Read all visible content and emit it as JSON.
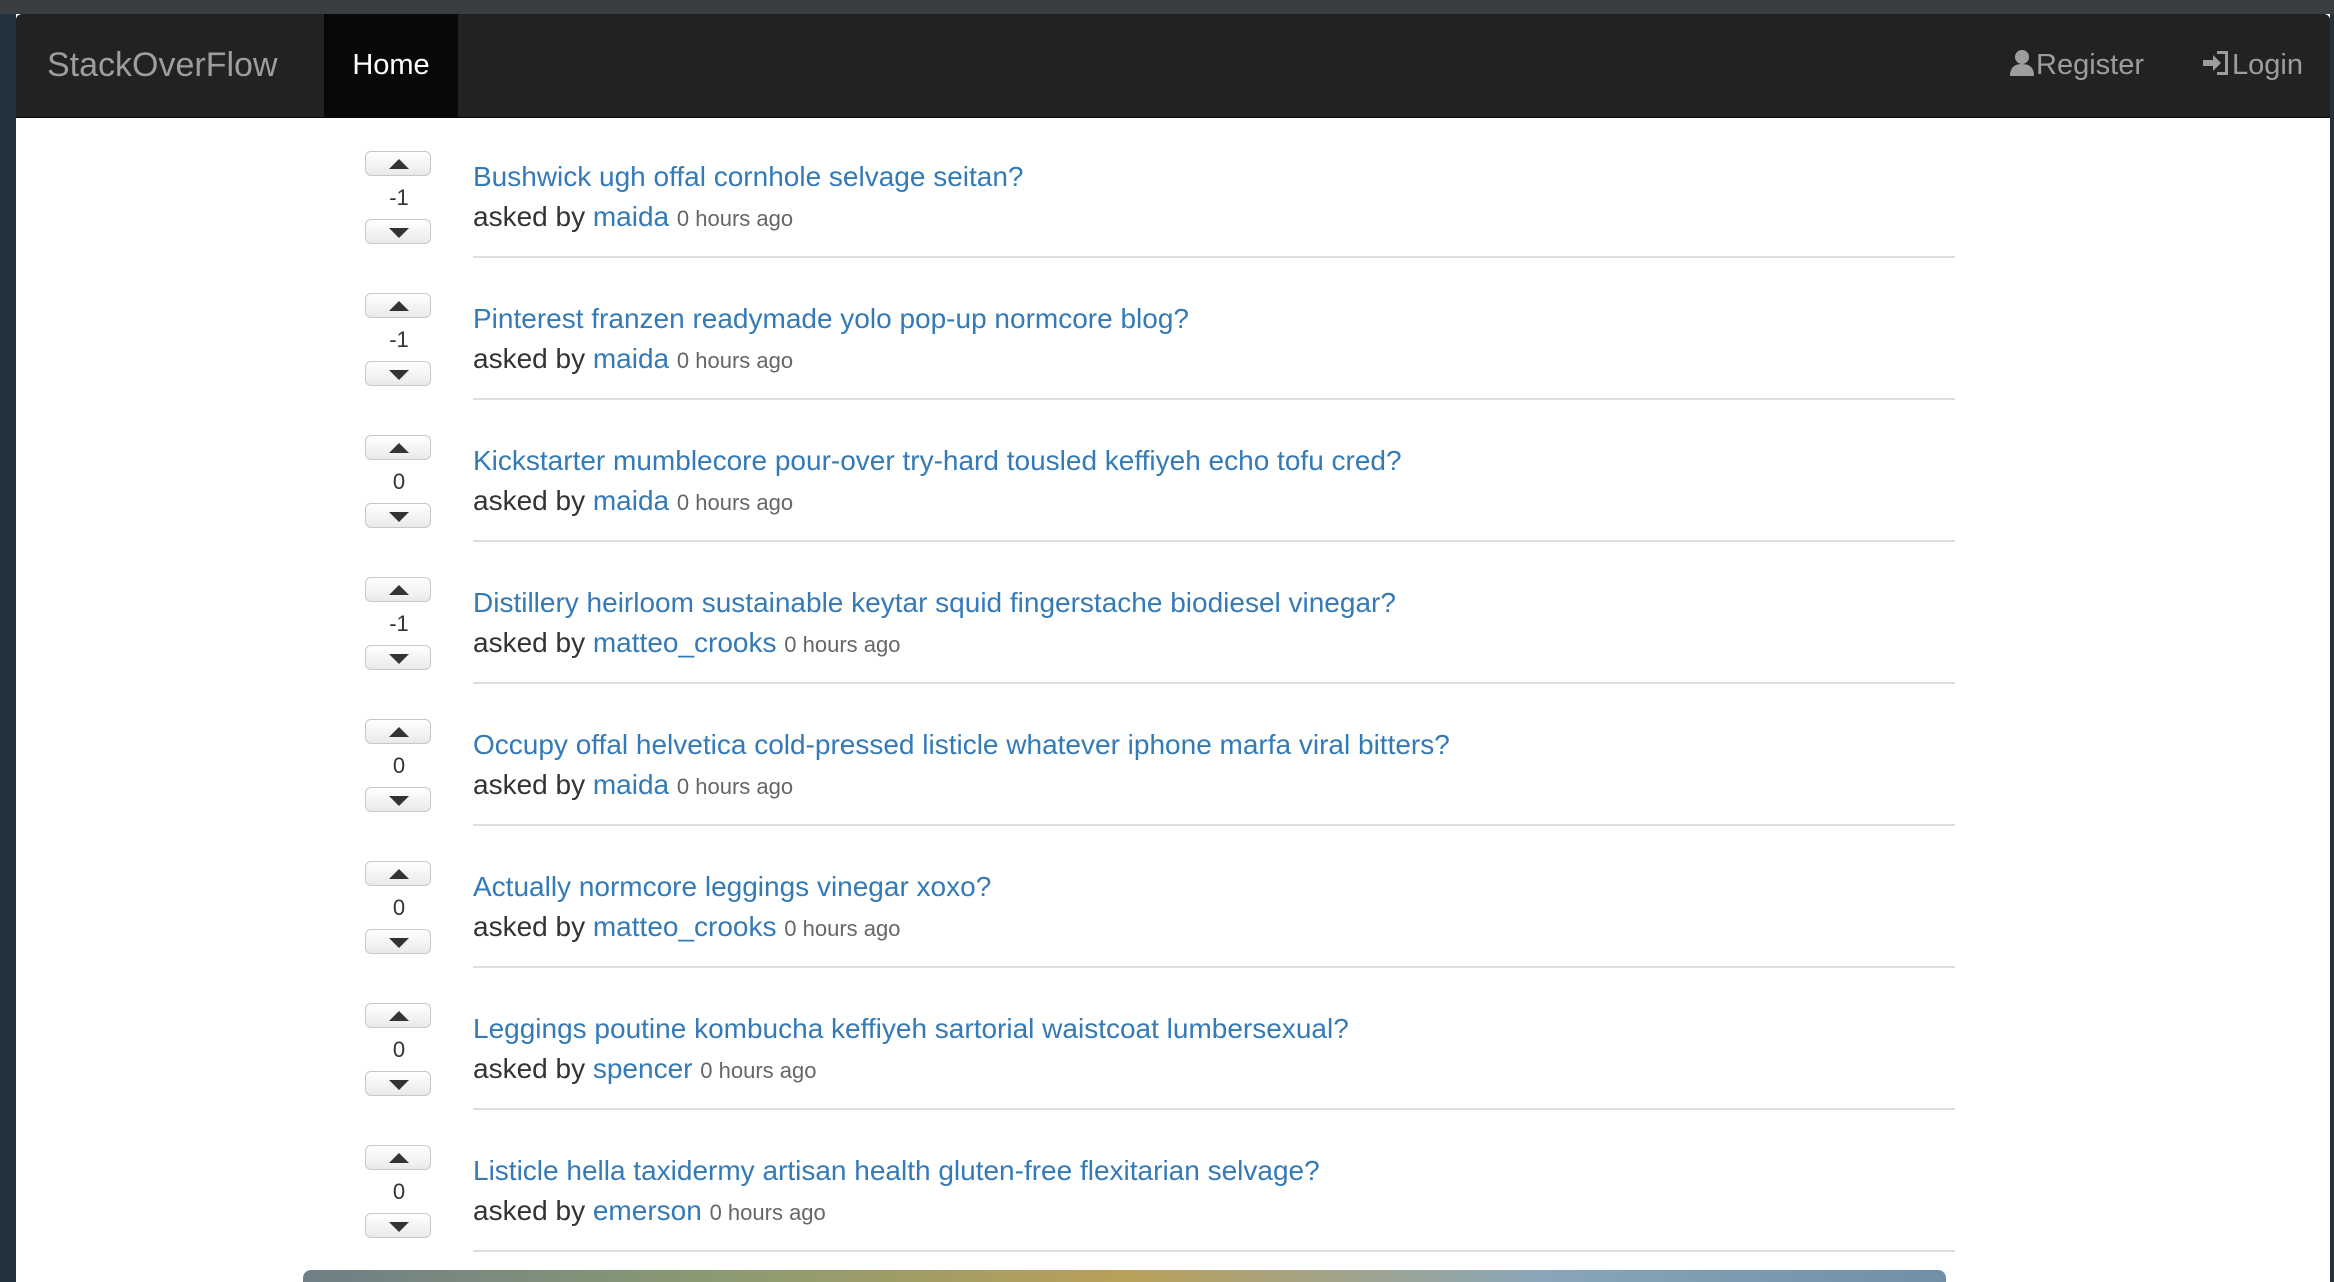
{
  "navbar": {
    "brand": "StackOverFlow",
    "home_label": "Home",
    "register_label": "Register",
    "login_label": "Login"
  },
  "questions": [
    {
      "votes": "-1",
      "title": "Bushwick ugh offal cornhole selvage seitan?",
      "asked_by_label": "asked by",
      "author": "maida",
      "time": "0 hours ago"
    },
    {
      "votes": "-1",
      "title": "Pinterest franzen readymade yolo pop-up normcore blog?",
      "asked_by_label": "asked by",
      "author": "maida",
      "time": "0 hours ago"
    },
    {
      "votes": "0",
      "title": "Kickstarter mumblecore pour-over try-hard tousled keffiyeh echo tofu cred?",
      "asked_by_label": "asked by",
      "author": "maida",
      "time": "0 hours ago"
    },
    {
      "votes": "-1",
      "title": "Distillery heirloom sustainable keytar squid fingerstache biodiesel vinegar?",
      "asked_by_label": "asked by",
      "author": "matteo_crooks",
      "time": "0 hours ago"
    },
    {
      "votes": "0",
      "title": "Occupy offal helvetica cold-pressed listicle whatever iphone marfa viral bitters?",
      "asked_by_label": "asked by",
      "author": "maida",
      "time": "0 hours ago"
    },
    {
      "votes": "0",
      "title": "Actually normcore leggings vinegar xoxo?",
      "asked_by_label": "asked by",
      "author": "matteo_crooks",
      "time": "0 hours ago"
    },
    {
      "votes": "0",
      "title": "Leggings poutine kombucha keffiyeh sartorial waistcoat lumbersexual?",
      "asked_by_label": "asked by",
      "author": "spencer",
      "time": "0 hours ago"
    },
    {
      "votes": "0",
      "title": "Listicle hella taxidermy artisan health gluten-free flexitarian selvage?",
      "asked_by_label": "asked by",
      "author": "emerson",
      "time": "0 hours ago"
    }
  ],
  "colors": {
    "navbar_bg": "#222222",
    "active_nav_bg": "#080808",
    "link": "#337ab7",
    "text": "#333333"
  },
  "icons": {
    "register": "user-icon",
    "login": "log-in-icon",
    "upvote": "triangle-up-icon",
    "downvote": "triangle-down-icon"
  }
}
